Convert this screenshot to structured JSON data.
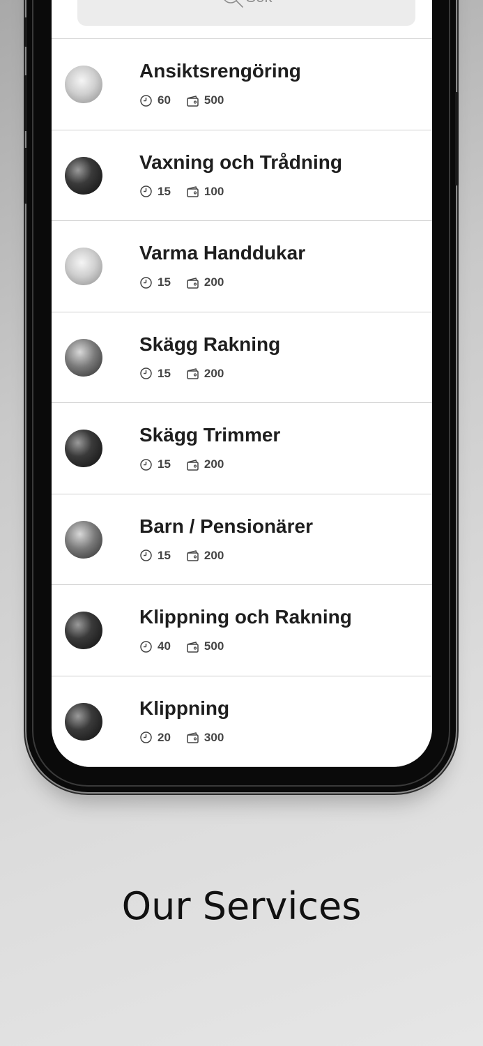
{
  "search": {
    "placeholder": "Sök"
  },
  "services": [
    {
      "name": "Ansiktsrengöring",
      "duration": "60",
      "price": "500",
      "avatar_tone": "light"
    },
    {
      "name": "Vaxning och Trådning",
      "duration": "15",
      "price": "100",
      "avatar_tone": "dark"
    },
    {
      "name": "Varma Handdukar",
      "duration": "15",
      "price": "200",
      "avatar_tone": "light"
    },
    {
      "name": "Skägg Rakning",
      "duration": "15",
      "price": "200",
      "avatar_tone": "mid"
    },
    {
      "name": "Skägg Trimmer",
      "duration": "15",
      "price": "200",
      "avatar_tone": "dark"
    },
    {
      "name": "Barn / Pensionärer",
      "duration": "15",
      "price": "200",
      "avatar_tone": "mid"
    },
    {
      "name": "Klippning och Rakning",
      "duration": "40",
      "price": "500",
      "avatar_tone": "dark"
    },
    {
      "name": "Klippning",
      "duration": "20",
      "price": "300",
      "avatar_tone": "dark"
    }
  ],
  "icons": {
    "duration": "clock-icon",
    "price": "wallet-icon",
    "search": "search-icon"
  },
  "caption": "Our Services"
}
